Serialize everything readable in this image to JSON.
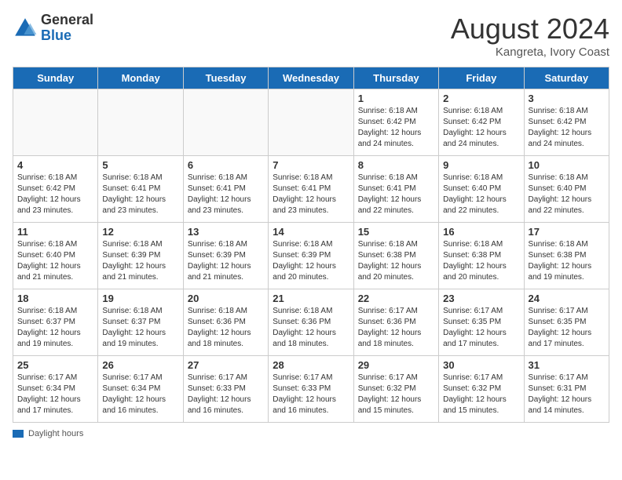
{
  "header": {
    "logo_general": "General",
    "logo_blue": "Blue",
    "month_title": "August 2024",
    "location": "Kangreta, Ivory Coast"
  },
  "days_of_week": [
    "Sunday",
    "Monday",
    "Tuesday",
    "Wednesday",
    "Thursday",
    "Friday",
    "Saturday"
  ],
  "legend_label": "Daylight hours",
  "weeks": [
    [
      {
        "day": "",
        "info": ""
      },
      {
        "day": "",
        "info": ""
      },
      {
        "day": "",
        "info": ""
      },
      {
        "day": "",
        "info": ""
      },
      {
        "day": "1",
        "info": "Sunrise: 6:18 AM\nSunset: 6:42 PM\nDaylight: 12 hours\nand 24 minutes."
      },
      {
        "day": "2",
        "info": "Sunrise: 6:18 AM\nSunset: 6:42 PM\nDaylight: 12 hours\nand 24 minutes."
      },
      {
        "day": "3",
        "info": "Sunrise: 6:18 AM\nSunset: 6:42 PM\nDaylight: 12 hours\nand 24 minutes."
      }
    ],
    [
      {
        "day": "4",
        "info": "Sunrise: 6:18 AM\nSunset: 6:42 PM\nDaylight: 12 hours\nand 23 minutes."
      },
      {
        "day": "5",
        "info": "Sunrise: 6:18 AM\nSunset: 6:41 PM\nDaylight: 12 hours\nand 23 minutes."
      },
      {
        "day": "6",
        "info": "Sunrise: 6:18 AM\nSunset: 6:41 PM\nDaylight: 12 hours\nand 23 minutes."
      },
      {
        "day": "7",
        "info": "Sunrise: 6:18 AM\nSunset: 6:41 PM\nDaylight: 12 hours\nand 23 minutes."
      },
      {
        "day": "8",
        "info": "Sunrise: 6:18 AM\nSunset: 6:41 PM\nDaylight: 12 hours\nand 22 minutes."
      },
      {
        "day": "9",
        "info": "Sunrise: 6:18 AM\nSunset: 6:40 PM\nDaylight: 12 hours\nand 22 minutes."
      },
      {
        "day": "10",
        "info": "Sunrise: 6:18 AM\nSunset: 6:40 PM\nDaylight: 12 hours\nand 22 minutes."
      }
    ],
    [
      {
        "day": "11",
        "info": "Sunrise: 6:18 AM\nSunset: 6:40 PM\nDaylight: 12 hours\nand 21 minutes."
      },
      {
        "day": "12",
        "info": "Sunrise: 6:18 AM\nSunset: 6:39 PM\nDaylight: 12 hours\nand 21 minutes."
      },
      {
        "day": "13",
        "info": "Sunrise: 6:18 AM\nSunset: 6:39 PM\nDaylight: 12 hours\nand 21 minutes."
      },
      {
        "day": "14",
        "info": "Sunrise: 6:18 AM\nSunset: 6:39 PM\nDaylight: 12 hours\nand 20 minutes."
      },
      {
        "day": "15",
        "info": "Sunrise: 6:18 AM\nSunset: 6:38 PM\nDaylight: 12 hours\nand 20 minutes."
      },
      {
        "day": "16",
        "info": "Sunrise: 6:18 AM\nSunset: 6:38 PM\nDaylight: 12 hours\nand 20 minutes."
      },
      {
        "day": "17",
        "info": "Sunrise: 6:18 AM\nSunset: 6:38 PM\nDaylight: 12 hours\nand 19 minutes."
      }
    ],
    [
      {
        "day": "18",
        "info": "Sunrise: 6:18 AM\nSunset: 6:37 PM\nDaylight: 12 hours\nand 19 minutes."
      },
      {
        "day": "19",
        "info": "Sunrise: 6:18 AM\nSunset: 6:37 PM\nDaylight: 12 hours\nand 19 minutes."
      },
      {
        "day": "20",
        "info": "Sunrise: 6:18 AM\nSunset: 6:36 PM\nDaylight: 12 hours\nand 18 minutes."
      },
      {
        "day": "21",
        "info": "Sunrise: 6:18 AM\nSunset: 6:36 PM\nDaylight: 12 hours\nand 18 minutes."
      },
      {
        "day": "22",
        "info": "Sunrise: 6:17 AM\nSunset: 6:36 PM\nDaylight: 12 hours\nand 18 minutes."
      },
      {
        "day": "23",
        "info": "Sunrise: 6:17 AM\nSunset: 6:35 PM\nDaylight: 12 hours\nand 17 minutes."
      },
      {
        "day": "24",
        "info": "Sunrise: 6:17 AM\nSunset: 6:35 PM\nDaylight: 12 hours\nand 17 minutes."
      }
    ],
    [
      {
        "day": "25",
        "info": "Sunrise: 6:17 AM\nSunset: 6:34 PM\nDaylight: 12 hours\nand 17 minutes."
      },
      {
        "day": "26",
        "info": "Sunrise: 6:17 AM\nSunset: 6:34 PM\nDaylight: 12 hours\nand 16 minutes."
      },
      {
        "day": "27",
        "info": "Sunrise: 6:17 AM\nSunset: 6:33 PM\nDaylight: 12 hours\nand 16 minutes."
      },
      {
        "day": "28",
        "info": "Sunrise: 6:17 AM\nSunset: 6:33 PM\nDaylight: 12 hours\nand 16 minutes."
      },
      {
        "day": "29",
        "info": "Sunrise: 6:17 AM\nSunset: 6:32 PM\nDaylight: 12 hours\nand 15 minutes."
      },
      {
        "day": "30",
        "info": "Sunrise: 6:17 AM\nSunset: 6:32 PM\nDaylight: 12 hours\nand 15 minutes."
      },
      {
        "day": "31",
        "info": "Sunrise: 6:17 AM\nSunset: 6:31 PM\nDaylight: 12 hours\nand 14 minutes."
      }
    ]
  ]
}
